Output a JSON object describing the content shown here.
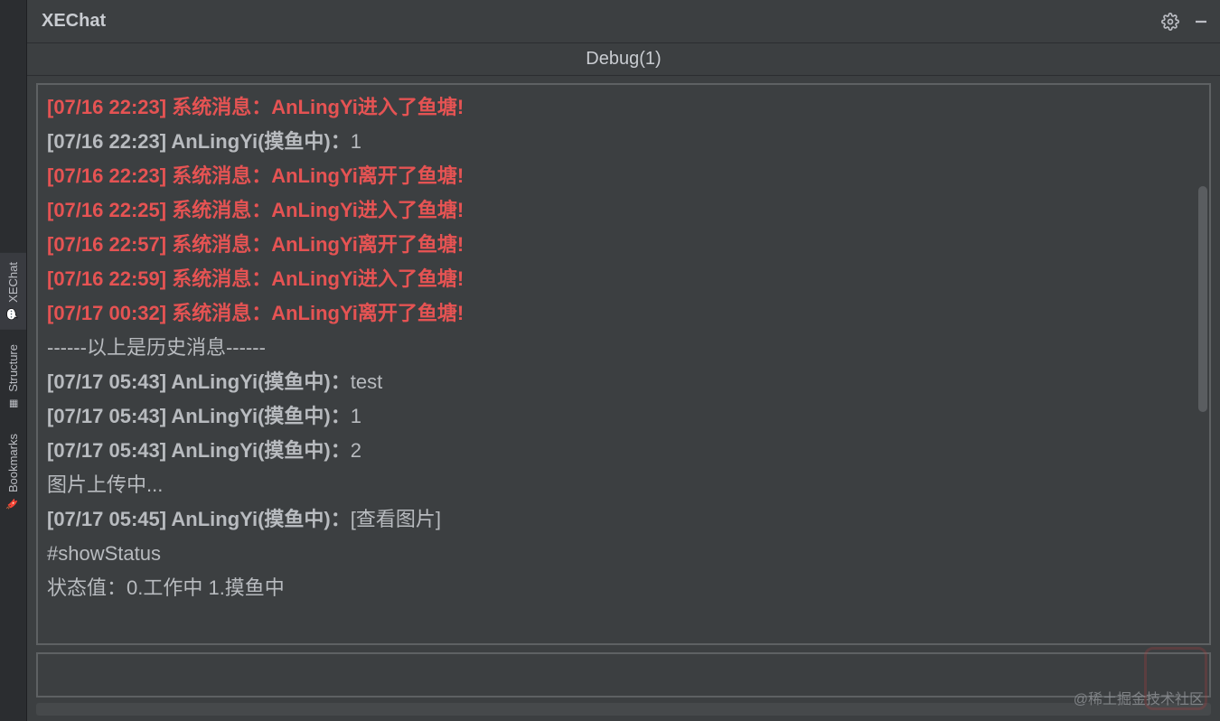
{
  "sideTabs": {
    "xechat": "XEChat",
    "structure": "Structure",
    "bookmarks": "Bookmarks"
  },
  "title": "XEChat",
  "tab": "Debug(1)",
  "messages": [
    {
      "type": "sys",
      "timestamp": "[07/16 22:23]",
      "label": "系统消息：",
      "text": "AnLingYi进入了鱼塘!"
    },
    {
      "type": "norm",
      "timestamp": "[07/16 22:23]",
      "label": "AnLingYi(摸鱼中)：",
      "text": "1"
    },
    {
      "type": "sys",
      "timestamp": "[07/16 22:23]",
      "label": "系统消息：",
      "text": "AnLingYi离开了鱼塘!"
    },
    {
      "type": "sys",
      "timestamp": "[07/16 22:25]",
      "label": "系统消息：",
      "text": "AnLingYi进入了鱼塘!"
    },
    {
      "type": "sys",
      "timestamp": "[07/16 22:57]",
      "label": "系统消息：",
      "text": "AnLingYi离开了鱼塘!"
    },
    {
      "type": "sys",
      "timestamp": "[07/16 22:59]",
      "label": "系统消息：",
      "text": "AnLingYi进入了鱼塘!"
    },
    {
      "type": "sys",
      "timestamp": "[07/17 00:32]",
      "label": "系统消息：",
      "text": "AnLingYi离开了鱼塘!"
    },
    {
      "type": "divider",
      "text": "------以上是历史消息------"
    },
    {
      "type": "norm",
      "timestamp": "[07/17 05:43]",
      "label": "AnLingYi(摸鱼中)：",
      "text": "test"
    },
    {
      "type": "norm",
      "timestamp": "[07/17 05:43]",
      "label": "AnLingYi(摸鱼中)：",
      "text": "1"
    },
    {
      "type": "norm",
      "timestamp": "[07/17 05:43]",
      "label": "AnLingYi(摸鱼中)：",
      "text": "2"
    },
    {
      "type": "plain",
      "text": "图片上传中..."
    },
    {
      "type": "norm",
      "timestamp": "[07/17 05:45]",
      "label": "AnLingYi(摸鱼中)：",
      "text": "[查看图片]"
    },
    {
      "type": "plain",
      "text": "#showStatus"
    },
    {
      "type": "plain",
      "text": "状态值：0.工作中 1.摸鱼中"
    }
  ],
  "input": {
    "value": ""
  },
  "watermark": "@稀土掘金技术社区"
}
